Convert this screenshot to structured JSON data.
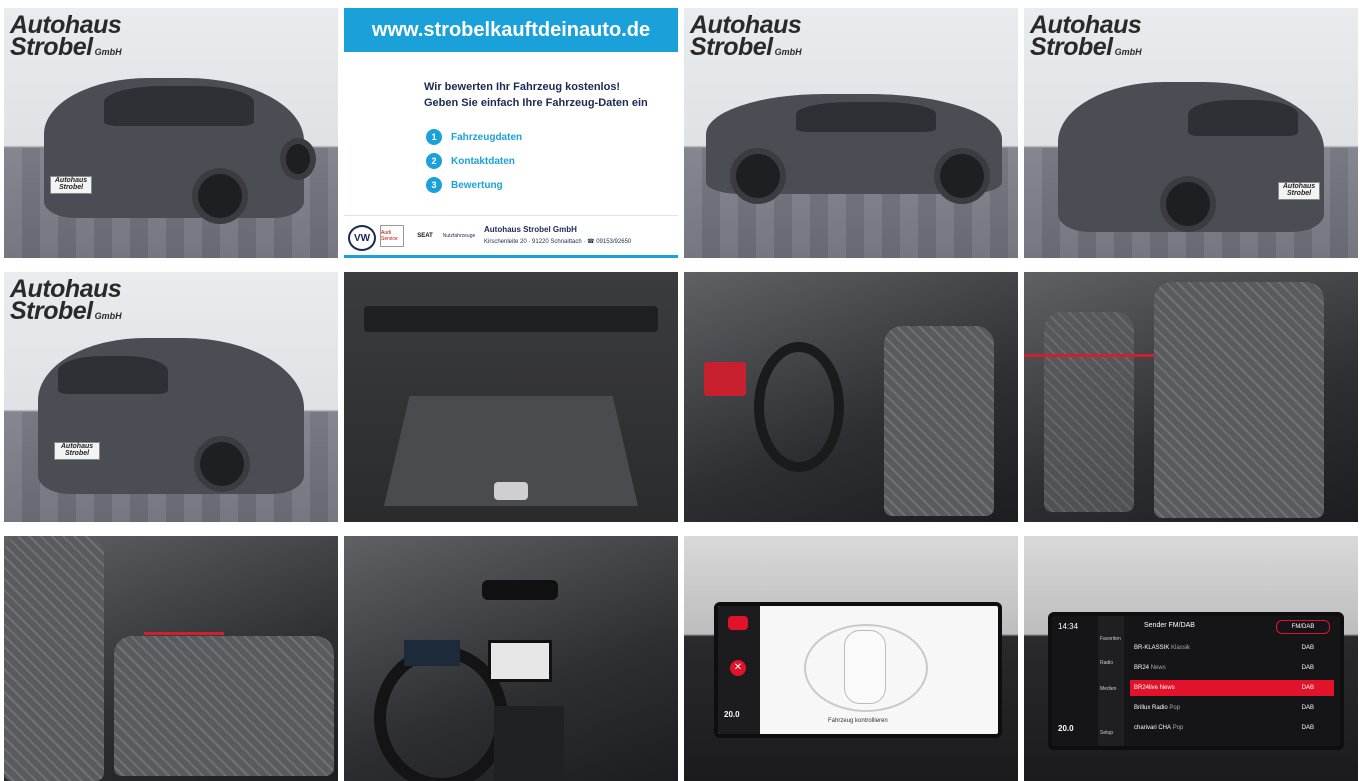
{
  "dealer_logo": {
    "line1": "Autohaus",
    "line2": "Strobel",
    "suffix": "GmbH"
  },
  "plate_text": "Autohaus Strobel",
  "promo": {
    "url": "www.strobelkauftdeinauto.de",
    "headline1": "Wir bewerten Ihr Fahrzeug kostenlos!",
    "headline2": "Geben Sie einfach Ihre Fahrzeug-Daten ein",
    "steps": [
      {
        "num": "1",
        "label": "Fahrzeugdaten"
      },
      {
        "num": "2",
        "label": "Kontaktdaten"
      },
      {
        "num": "3",
        "label": "Bewertung"
      }
    ],
    "brands": {
      "vw": "VW",
      "audi": "Audi Service",
      "seat": "SEAT",
      "vwn": "Nutzfahrzeuge"
    },
    "dealer_name": "Autohaus Strobel GmbH",
    "dealer_address": "Kirschenleite 20 · 91220 Schnaittach · ☎ 09153/92650"
  },
  "parking_display": {
    "temp": "20.0",
    "warning": "Fahrzeug kontrollieren"
  },
  "radio_display": {
    "time": "14:34",
    "temp": "20.0",
    "header": "Sender FM/DAB",
    "band": "FM/DAB",
    "side_items": [
      "Favoriten",
      "Radio",
      "Medien",
      "Setup"
    ],
    "stations": [
      {
        "name": "BR-KLASSIK",
        "genre": "Klassik",
        "tag": "DAB"
      },
      {
        "name": "BR24",
        "genre": "News",
        "tag": "DAB"
      },
      {
        "name": "BR24live",
        "genre": "News",
        "tag": "DAB"
      },
      {
        "name": "Brillux Radio",
        "genre": "Pop",
        "tag": "DAB"
      },
      {
        "name": "charivari CHA",
        "genre": "Pop",
        "tag": "DAB"
      }
    ],
    "selected_index": 2
  },
  "colors": {
    "accent": "#1ba1d9",
    "brand_navy": "#1b2a52",
    "car_grey": "#4a4d53",
    "radio_red": "#e0132a"
  }
}
